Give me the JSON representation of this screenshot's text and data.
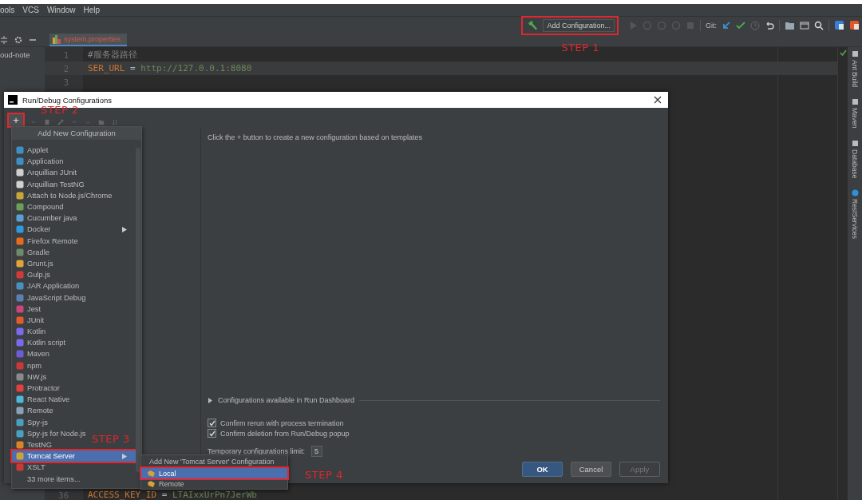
{
  "menu_bar": [
    "ools",
    "VCS",
    "Window",
    "Help"
  ],
  "toolbar": {
    "add_configuration": {
      "label": "Add Configuration...",
      "step": "STEP 1"
    },
    "git_label": "Git:"
  },
  "project_panel": {
    "label": "oud-note"
  },
  "editor_tab": {
    "label": "system.properties",
    "selected": true
  },
  "editor": {
    "lines": [
      {
        "number": "1",
        "kind": "comment",
        "text": "#服务器路径",
        "current": false
      },
      {
        "number": "2",
        "kind": "property",
        "key": "SER_URL",
        "operator": "=",
        "value": "http://127.0.0.1:8080",
        "current": true
      },
      {
        "number": "3",
        "kind": "empty",
        "current": false
      }
    ],
    "bottom_line": {
      "number": "36",
      "kind": "property",
      "key": "ACCESS_KEY_ID",
      "operator": "=",
      "value": "LTAIxxUrPn7JerWb"
    }
  },
  "right_stripe": [
    "Ant Build",
    "Maven",
    "Database",
    "RestServices"
  ],
  "dialog": {
    "title": "Run/Debug Configurations",
    "add_button": {
      "label": "+",
      "step": "STEP 2"
    },
    "hint": "Click the + button to create a new configuration based on templates",
    "dashboard": {
      "label": "Configurations available in Run Dashboard",
      "expanded": false
    },
    "options": [
      {
        "label": "Confirm rerun with process termination",
        "checked": true
      },
      {
        "label": "Confirm deletion from Run/Debug popup",
        "checked": true
      }
    ],
    "limit": {
      "label": "Temporary configurations limit:",
      "value": "5"
    },
    "buttons": [
      {
        "label": "OK",
        "kind": "default",
        "disabled": false
      },
      {
        "label": "Cancel",
        "kind": "normal",
        "disabled": false
      },
      {
        "label": "Apply",
        "kind": "normal",
        "disabled": true
      }
    ]
  },
  "add_menu": {
    "title": "Add New Configuration",
    "items": [
      {
        "label": "Applet",
        "selected": false,
        "submenu": false
      },
      {
        "label": "Application",
        "selected": false,
        "submenu": false
      },
      {
        "label": "Arquillian JUnit",
        "selected": false,
        "submenu": false
      },
      {
        "label": "Arquillian TestNG",
        "selected": false,
        "submenu": false
      },
      {
        "label": "Attach to Node.js/Chrome",
        "selected": false,
        "submenu": false
      },
      {
        "label": "Compound",
        "selected": false,
        "submenu": false
      },
      {
        "label": "Cucumber java",
        "selected": false,
        "submenu": false
      },
      {
        "label": "Docker",
        "selected": false,
        "submenu": true
      },
      {
        "label": "Firefox Remote",
        "selected": false,
        "submenu": false
      },
      {
        "label": "Gradle",
        "selected": false,
        "submenu": false
      },
      {
        "label": "Grunt.js",
        "selected": false,
        "submenu": false
      },
      {
        "label": "Gulp.js",
        "selected": false,
        "submenu": false
      },
      {
        "label": "JAR Application",
        "selected": false,
        "submenu": false
      },
      {
        "label": "JavaScript Debug",
        "selected": false,
        "submenu": false
      },
      {
        "label": "Jest",
        "selected": false,
        "submenu": false
      },
      {
        "label": "JUnit",
        "selected": false,
        "submenu": false
      },
      {
        "label": "Kotlin",
        "selected": false,
        "submenu": false
      },
      {
        "label": "Kotlin script",
        "selected": false,
        "submenu": false
      },
      {
        "label": "Maven",
        "selected": false,
        "submenu": false
      },
      {
        "label": "npm",
        "selected": false,
        "submenu": false
      },
      {
        "label": "NW.js",
        "selected": false,
        "submenu": false
      },
      {
        "label": "Protractor",
        "selected": false,
        "submenu": false
      },
      {
        "label": "React Native",
        "selected": false,
        "submenu": false
      },
      {
        "label": "Remote",
        "selected": false,
        "submenu": false
      },
      {
        "label": "Spy-js",
        "selected": false,
        "submenu": false
      },
      {
        "label": "Spy-js for Node.js",
        "selected": false,
        "submenu": false
      },
      {
        "label": "TestNG",
        "selected": false,
        "submenu": false
      },
      {
        "label": "Tomcat Server",
        "selected": true,
        "submenu": true,
        "step": "STEP 3"
      },
      {
        "label": "XSLT",
        "selected": false,
        "submenu": false
      },
      {
        "label": "33 more items...",
        "selected": false,
        "submenu": false,
        "kind": "more"
      }
    ]
  },
  "submenu": {
    "title": "Add New 'Tomcat Server' Configuration",
    "items": [
      {
        "label": "Local",
        "selected": true,
        "step": "STEP 4"
      },
      {
        "label": "Remote",
        "selected": false
      }
    ]
  }
}
